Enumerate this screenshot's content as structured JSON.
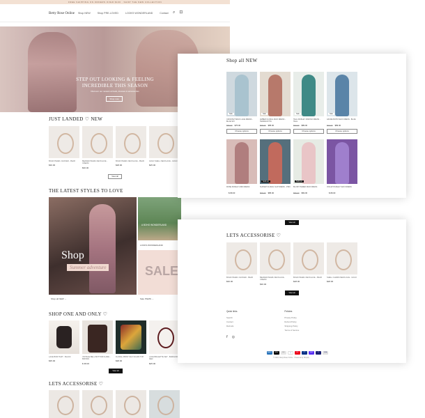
{
  "announcement": "FREE SHIPPING ON ORDERS OVER $100 · SHOP THE NEW COLLECTION",
  "header": {
    "logo": "Betty Rose Online",
    "nav": [
      "Shop NEW",
      "Shop PRE-LOVED",
      "LOOKS WONDERLAND",
      "Contact"
    ]
  },
  "hero": {
    "title": "STEP OUT LOOKING & FEELING INCREDIBLE THIS SEASON",
    "subtitle": "Discover our newest arrivals, dresses & accessories",
    "button": "Shop now"
  },
  "just_landed": {
    "title": "JUST LANDED ♡ NEW",
    "items": [
      {
        "name": "BOHO PEARL CHOKER - PEAR",
        "price": "$30.00"
      },
      {
        "name": "BEADED PEARL NECKLACE - CREAM",
        "price": "$30.00"
      },
      {
        "name": "BOHO PEARL NECKLACE - PEAR",
        "price": "$28.00"
      },
      {
        "name": "GOLD SHELL NECKLACE - GOLD",
        "price": "$25.00"
      }
    ],
    "view_all": "View all"
  },
  "latest": {
    "title": "THE LATEST STYLES TO LOVE",
    "shop_text": "Shop",
    "adventure_text": "Summer adventure",
    "dog_tag": "A BOHO WONDERLAND",
    "dog_caption": "LOOKS WONDERLAND",
    "sale_text": "SALE",
    "caption_left": "Shop all NEW →",
    "caption_right": "Sale ITEMS →"
  },
  "one_and_only": {
    "title": "SHOP ONE AND ONLY ♡",
    "items": [
      {
        "name": "LACE BODYSUIT - BLACK",
        "price": "$35.00"
      },
      {
        "name": "VINTAGE BELL BOTTOM FLARE - BROWN",
        "price": "$ 38.00"
      },
      {
        "name": "FLORAL PRINT SILK SCARF TOP",
        "price": "$38.00"
      },
      {
        "name": "LACE BRALETTE SET - BURGUNDY RED",
        "price": "$25.00"
      }
    ],
    "view_all": "View all"
  },
  "lets_accessorise_back": {
    "title": "LETS ACCESSORISE ♡"
  },
  "shop_all_new": {
    "title": "Shop all NEW",
    "row1": [
      {
        "name": "CROCHET BACK LACE DRESS - BLUE SKY",
        "old": "$89.00",
        "price": "$75.00",
        "badge": "Sale",
        "badge_dark": false,
        "choose": "Choose options",
        "c1": "#cfd9df",
        "c2": "#a9c3cf"
      },
      {
        "name": "AMBER FLORAL MAXI DRESS - TERRACOTTA",
        "old": "$95.00",
        "price": "$85.00",
        "badge": "Sale",
        "badge_dark": false,
        "choose": "Choose options",
        "c1": "#e3dbd1",
        "c2": "#b7796b"
      },
      {
        "name": "TEAL PAISLEY KIMONO DRESS - TEAL",
        "old": "$99.00",
        "price": "$89.00",
        "badge": "Sale",
        "badge_dark": false,
        "choose": "Choose options",
        "c1": "#e8ede9",
        "c2": "#3f8a86"
      },
      {
        "name": "AZURE BOHO MAXI DRESS - BLUE",
        "old": "$99.00",
        "price": "$89.00",
        "badge": "Sale",
        "badge_dark": false,
        "choose": "Choose options",
        "c1": "#dce5ea",
        "c2": "#5a84a8"
      }
    ],
    "row2": [
      {
        "name": "ROSE PAISLEY MIDI DRESS",
        "old": "",
        "price": "$ 89.00",
        "badge": "",
        "badge_dark": false,
        "c1": "#d8bcb8",
        "c2": "#b07e7e"
      },
      {
        "name": "SUNSET FLORAL SLIP DRESS - PINK",
        "old": "$95.00",
        "price": "$85.00",
        "badge": "Sold out",
        "badge_dark": true,
        "c1": "#556f7c",
        "c2": "#c16a5d"
      },
      {
        "name": "BLUSH TIERED MAXI DRESS",
        "old": "$89.00",
        "price": "$69.00",
        "badge": "Sold out",
        "badge_dark": true,
        "c1": "#e6ebe4",
        "c2": "#e9c5c7"
      },
      {
        "name": "VIOLET PAISLEY MAXI DRESS",
        "old": "",
        "price": "$ 89.00",
        "badge": "",
        "badge_dark": false,
        "c1": "#7b55a3",
        "c2": "#9f7fcd"
      }
    ]
  },
  "lets_accessorise": {
    "title": "LETS ACCESSORISE ♡",
    "top_button": "View all",
    "items": [
      {
        "name": "BOHO PEARL CHOKER - PEAR",
        "price": "$30.00"
      },
      {
        "name": "BEADED PEARL NECKLACE - CREAM",
        "price": "$30.00"
      },
      {
        "name": "BOHO PEARL NECKLACE - PEAR",
        "price": "$28.00"
      },
      {
        "name": "SHELL CHARM NECKLACE - GOLD",
        "price": "$28.00"
      }
    ],
    "view_all": "View all"
  },
  "footer": {
    "quick_links_title": "Quick links",
    "quick_links": [
      "Search",
      "Contact",
      "Refunds"
    ],
    "policies_title": "Policies",
    "policies": [
      "Privacy Policy",
      "Refund Policy",
      "Shipping Policy",
      "Terms of Service"
    ],
    "social": [
      "f",
      "◎"
    ],
    "payments": [
      "AMEX",
      "APAY",
      "DC",
      "G",
      "MC",
      "PP",
      "SHP",
      "V",
      "VISA"
    ],
    "copyright": "© 2024, Betty Rose Online · Powered by Shopify"
  },
  "colors": {
    "announcement_bg": "#f3e1d3",
    "dark_button": "#111111"
  }
}
